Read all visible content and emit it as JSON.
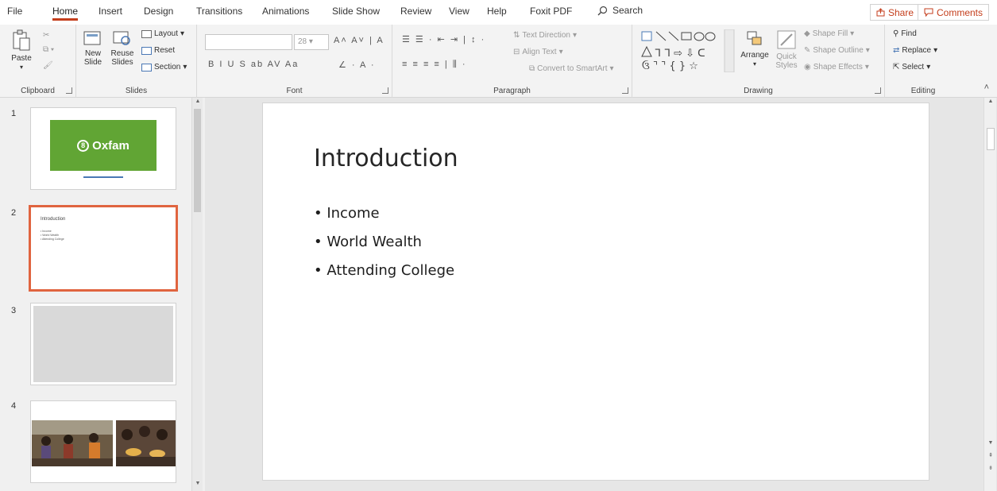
{
  "menu": {
    "tabs": [
      "File",
      "Home",
      "Insert",
      "Design",
      "Transitions",
      "Animations",
      "Slide Show",
      "Review",
      "View",
      "Help",
      "Foxit PDF"
    ],
    "search_label": "Search",
    "share_label": "Share",
    "comments_label": "Comments"
  },
  "ribbon": {
    "clipboard": {
      "label": "Clipboard",
      "paste": "Paste"
    },
    "slides": {
      "label": "Slides",
      "new_slide": "New Slide",
      "reuse_slides": "Reuse Slides",
      "layout": "Layout",
      "reset": "Reset",
      "section": "Section"
    },
    "font": {
      "label": "Font",
      "size": "28",
      "format_row": "B  I  U  S  ab  AV  Aa"
    },
    "paragraph": {
      "label": "Paragraph",
      "text_direction": "Text Direction",
      "align_text": "Align Text",
      "convert_smartart": "Convert to SmartArt"
    },
    "drawing": {
      "label": "Drawing",
      "arrange": "Arrange",
      "quick_styles": "Quick Styles",
      "shape_fill": "Shape Fill",
      "shape_outline": "Shape Outline",
      "shape_effects": "Shape Effects"
    },
    "editing": {
      "label": "Editing",
      "find": "Find",
      "replace": "Replace",
      "select": "Select"
    }
  },
  "thumbnails": [
    {
      "number": "1",
      "brand": "Oxfam"
    },
    {
      "number": "2",
      "title": "Introduction",
      "lines": [
        "• Income",
        "• World Wealth",
        "• Attending College"
      ]
    },
    {
      "number": "3"
    },
    {
      "number": "4"
    }
  ],
  "slide": {
    "title": "Introduction",
    "bullets": [
      "Income",
      "World Wealth",
      "Attending College"
    ]
  },
  "colors": {
    "accent": "#c43e1c",
    "oxfam_green": "#61a534",
    "selection": "#e0643f"
  }
}
